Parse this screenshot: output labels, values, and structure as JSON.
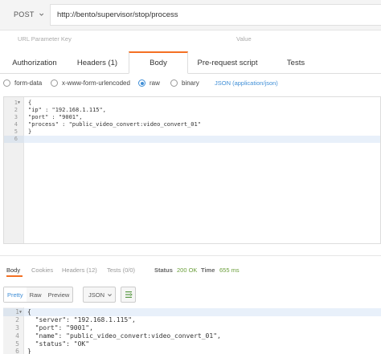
{
  "request": {
    "method": "POST",
    "url": "http://bento/supervisor/stop/process",
    "params": {
      "key_placeholder": "URL Parameter Key",
      "value_placeholder": "Value"
    },
    "tabs": [
      {
        "label": "Authorization"
      },
      {
        "label": "Headers (1)"
      },
      {
        "label": "Body"
      },
      {
        "label": "Pre-request script"
      },
      {
        "label": "Tests"
      }
    ],
    "active_tab": "Body",
    "body_types": [
      {
        "label": "form-data"
      },
      {
        "label": "x-www-form-urlencoded"
      },
      {
        "label": "raw"
      },
      {
        "label": "binary"
      }
    ],
    "selected_body_type": "raw",
    "content_type": "JSON (application/json)",
    "body_line_numbers": [
      "1",
      "2",
      "3",
      "4",
      "5",
      "6"
    ],
    "body_lines": [
      "{",
      "\"ip\" : \"192.168.1.115\",",
      "\"port\" : \"9001\",",
      "\"process\" : \"public_video_convert:video_convert_01\"",
      "}",
      ""
    ]
  },
  "response": {
    "tabs": [
      {
        "label": "Body"
      },
      {
        "label": "Cookies"
      },
      {
        "label": "Headers (12)"
      },
      {
        "label": "Tests (0/0)"
      }
    ],
    "status_label": "Status",
    "status_value": "200 OK",
    "time_label": "Time",
    "time_value": "655 ms",
    "view_modes": [
      {
        "label": "Pretty"
      },
      {
        "label": "Raw"
      },
      {
        "label": "Preview"
      }
    ],
    "active_view": "Pretty",
    "format": "JSON",
    "body_line_numbers": [
      "1",
      "2",
      "3",
      "4",
      "5",
      "6"
    ],
    "body_lines": [
      "{",
      "  \"server\": \"192.168.1.115\",",
      "  \"port\": \"9001\",",
      "  \"name\": \"public_video_convert:video_convert_01\",",
      "  \"status\": \"OK\"",
      "}"
    ]
  },
  "colors": {
    "accent_tab": "#f47023",
    "link_blue": "#3f8ed6",
    "status_green": "#6a9e3a"
  },
  "icons": {
    "method_dropdown": "chevron-down-icon",
    "format_dropdown": "chevron-down-icon",
    "wrap_toggle": "wrap-lines-icon",
    "fold_marker": "fold-arrow-icon"
  }
}
